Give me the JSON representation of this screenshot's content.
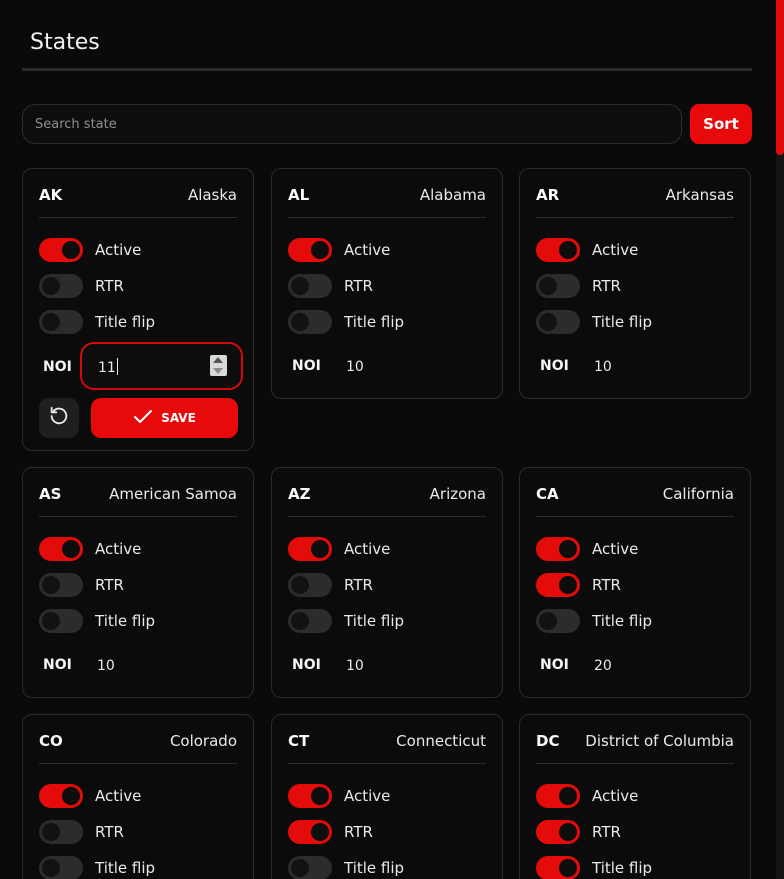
{
  "page": {
    "title": "States"
  },
  "search": {
    "placeholder": "Search state",
    "value": ""
  },
  "sort": {
    "label": "Sort"
  },
  "colors": {
    "accent": "#e80a0a",
    "background": "#0a0a0a",
    "card": "#0b0b0b",
    "toggle_off": "#2c2c2c"
  },
  "labels": {
    "active": "Active",
    "rtr": "RTR",
    "title_flip": "Title flip",
    "noi": "NOI",
    "save": "SAVE"
  },
  "icons": {
    "reset": "reset-icon",
    "save": "check-icon"
  },
  "cards": [
    {
      "code": "AK",
      "name": "Alaska",
      "active": true,
      "rtr": false,
      "title_flip": false,
      "noi": "11",
      "editing": true
    },
    {
      "code": "AL",
      "name": "Alabama",
      "active": true,
      "rtr": false,
      "title_flip": false,
      "noi": "10",
      "editing": false
    },
    {
      "code": "AR",
      "name": "Arkansas",
      "active": true,
      "rtr": false,
      "title_flip": false,
      "noi": "10",
      "editing": false
    },
    {
      "code": "AS",
      "name": "American Samoa",
      "active": true,
      "rtr": false,
      "title_flip": false,
      "noi": "10",
      "editing": false
    },
    {
      "code": "AZ",
      "name": "Arizona",
      "active": true,
      "rtr": false,
      "title_flip": false,
      "noi": "10",
      "editing": false
    },
    {
      "code": "CA",
      "name": "California",
      "active": true,
      "rtr": true,
      "title_flip": false,
      "noi": "20",
      "editing": false
    },
    {
      "code": "CO",
      "name": "Colorado",
      "active": true,
      "rtr": false,
      "title_flip": false,
      "noi": "",
      "editing": false
    },
    {
      "code": "CT",
      "name": "Connecticut",
      "active": true,
      "rtr": true,
      "title_flip": false,
      "noi": "",
      "editing": false
    },
    {
      "code": "DC",
      "name": "District of Columbia",
      "active": true,
      "rtr": true,
      "title_flip": true,
      "noi": "",
      "editing": false
    }
  ]
}
